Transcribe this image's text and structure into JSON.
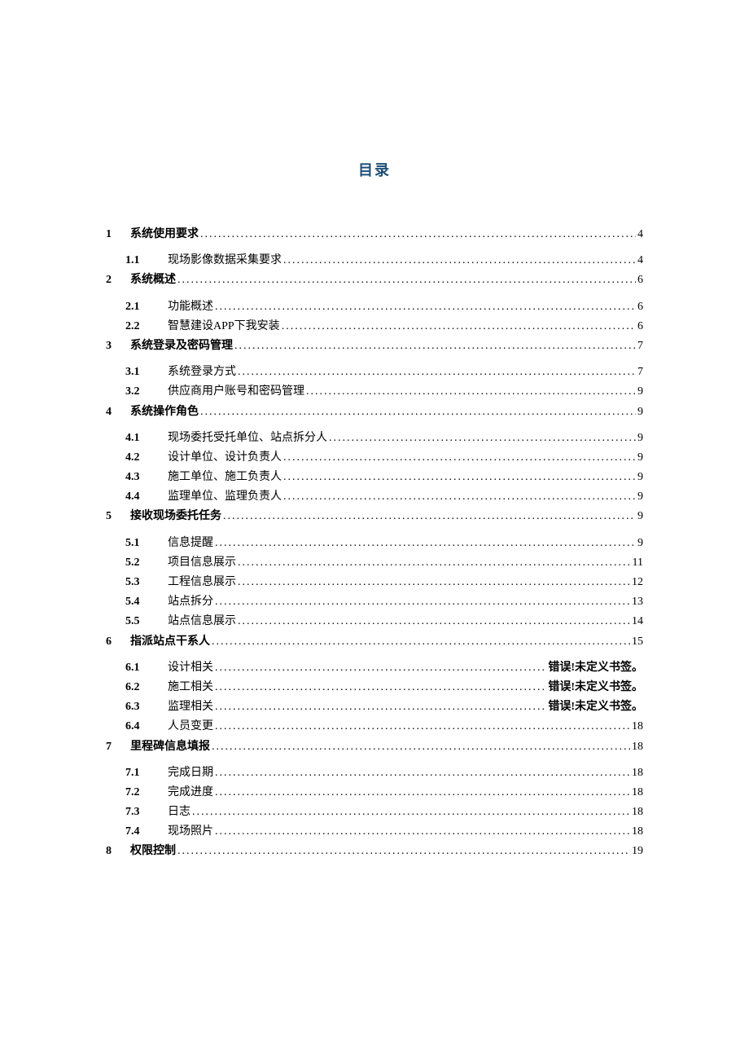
{
  "title": "目录",
  "toc": [
    {
      "num": "1",
      "label": "系统使用要求",
      "page": "4",
      "level": 1
    },
    {
      "num": "1.1",
      "label": "现场影像数据采集要求",
      "page": "4",
      "level": 2
    },
    {
      "num": "2",
      "label": "系统概述",
      "page": "6",
      "level": 1
    },
    {
      "num": "2.1",
      "label": "功能概述",
      "page": "6",
      "level": 2
    },
    {
      "num": "2.2",
      "label": "智慧建设APP下我安装",
      "page": "6",
      "level": 2
    },
    {
      "num": "3",
      "label": "系统登录及密码管理",
      "page": "7",
      "level": 1
    },
    {
      "num": "3.1",
      "label": "系统登录方式",
      "page": "7",
      "level": 2
    },
    {
      "num": "3.2",
      "label": "供应商用户账号和密码管理",
      "page": "9",
      "level": 2
    },
    {
      "num": "4",
      "label": "系统操作角色",
      "page": "9",
      "level": 1
    },
    {
      "num": "4.1",
      "label": "现场委托受托单位、站点拆分人",
      "page": "9",
      "level": 2
    },
    {
      "num": "4.2",
      "label": "设计单位、设计负责人",
      "page": "9",
      "level": 2
    },
    {
      "num": "4.3",
      "label": "施工单位、施工负责人",
      "page": "9",
      "level": 2
    },
    {
      "num": "4.4",
      "label": "监理单位、监理负责人",
      "page": "9",
      "level": 2
    },
    {
      "num": "5",
      "label": "接收现场委托任务",
      "page": "9",
      "level": 1
    },
    {
      "num": "5.1",
      "label": "信息提醒",
      "page": "9",
      "level": 2
    },
    {
      "num": "5.2",
      "label": "项目信息展示",
      "page": "11",
      "level": 2
    },
    {
      "num": "5.3",
      "label": "工程信息展示",
      "page": "12",
      "level": 2
    },
    {
      "num": "5.4",
      "label": "站点拆分",
      "page": "13",
      "level": 2
    },
    {
      "num": "5.5",
      "label": "站点信息展示",
      "page": "14",
      "level": 2
    },
    {
      "num": "6",
      "label": "指派站点干系人",
      "page": "15",
      "level": 1
    },
    {
      "num": "6.1",
      "label": "设计相关",
      "page": "错误!未定义书签。",
      "level": 2,
      "boldpage": true
    },
    {
      "num": "6.2",
      "label": "施工相关",
      "page": "错误!未定义书签。",
      "level": 2,
      "boldpage": true
    },
    {
      "num": "6.3",
      "label": "监理相关",
      "page": "错误!未定义书签。",
      "level": 2,
      "boldpage": true
    },
    {
      "num": "6.4",
      "label": "人员变更",
      "page": "18",
      "level": 2
    },
    {
      "num": "7",
      "label": "里程碑信息填报",
      "page": "18",
      "level": 1
    },
    {
      "num": "7.1",
      "label": "完成日期",
      "page": "18",
      "level": 2
    },
    {
      "num": "7.2",
      "label": "完成进度",
      "page": "18",
      "level": 2
    },
    {
      "num": "7.3",
      "label": "日志",
      "page": "18",
      "level": 2
    },
    {
      "num": "7.4",
      "label": "现场照片",
      "page": "18",
      "level": 2
    },
    {
      "num": "8",
      "label": "权限控制",
      "page": "19",
      "level": 1
    }
  ]
}
